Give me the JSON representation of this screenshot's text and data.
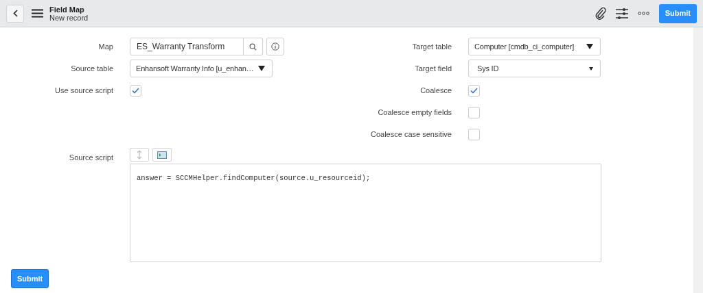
{
  "header": {
    "title": "Field Map",
    "subtitle": "New record",
    "submit": "Submit"
  },
  "left_fields": [
    {
      "kind": "reference",
      "label": "Map",
      "value": "ES_Warranty Transform"
    },
    {
      "kind": "select",
      "label": "Source table",
      "value": "Enhansoft Warranty Info [u_enhan…"
    },
    {
      "kind": "checkbox",
      "label": "Use source script",
      "checked": true
    }
  ],
  "right_fields": [
    {
      "kind": "select",
      "label": "Target table",
      "value": "Computer [cmdb_ci_computer]"
    },
    {
      "kind": "smallselect",
      "label": "Target field",
      "value": "Sys ID"
    },
    {
      "kind": "checkbox",
      "label": "Coalesce",
      "checked": true
    },
    {
      "kind": "checkbox",
      "label": "Coalesce empty fields",
      "checked": false
    },
    {
      "kind": "checkbox",
      "label": "Coalesce case sensitive",
      "checked": false
    }
  ],
  "source_script": {
    "label": "Source script",
    "code": "answer = SCCMHelper.findComputer(source.u_resourceid);"
  },
  "footer": {
    "submit": "Submit"
  }
}
